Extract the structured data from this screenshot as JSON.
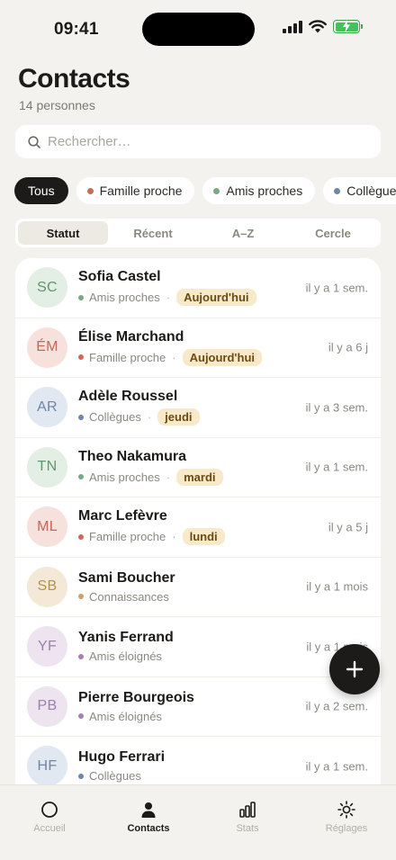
{
  "status_bar": {
    "time": "09:41"
  },
  "header": {
    "title": "Contacts",
    "subtitle": "14 personnes"
  },
  "search": {
    "placeholder": "Rechercher…",
    "value": ""
  },
  "filters": [
    {
      "label": "Tous",
      "active": true
    },
    {
      "label": "Famille proche",
      "dot_color": "#d0675a"
    },
    {
      "label": "Amis proches",
      "dot_color": "#7aa886"
    },
    {
      "label": "Collègues",
      "dot_color": "#6f86a8"
    }
  ],
  "sort_tabs": [
    {
      "label": "Statut",
      "active": true
    },
    {
      "label": "Récent"
    },
    {
      "label": "A–Z"
    },
    {
      "label": "Cercle"
    }
  ],
  "contacts": [
    {
      "initials": "SC",
      "name": "Sofia Castel",
      "circle": "Amis proches",
      "circle_color": "#7aa886",
      "badge": "Aujourd'hui",
      "last_seen": "il y a 1 sem.",
      "avatar_bg": "#e3efe4",
      "avatar_fg": "#5f9670"
    },
    {
      "initials": "ÉM",
      "name": "Élise Marchand",
      "circle": "Famille proche",
      "circle_color": "#d0675a",
      "badge": "Aujourd'hui",
      "last_seen": "il y a 6 j",
      "avatar_bg": "#f7e1dc",
      "avatar_fg": "#c36656"
    },
    {
      "initials": "AR",
      "name": "Adèle Roussel",
      "circle": "Collègues",
      "circle_color": "#6f86a8",
      "badge": "jeudi",
      "last_seen": "il y a 3 sem.",
      "avatar_bg": "#e2e8f1",
      "avatar_fg": "#6e85a7"
    },
    {
      "initials": "TN",
      "name": "Theo Nakamura",
      "circle": "Amis proches",
      "circle_color": "#7aa886",
      "badge": "mardi",
      "last_seen": "il y a 1 sem.",
      "avatar_bg": "#e3efe4",
      "avatar_fg": "#5f9670"
    },
    {
      "initials": "ML",
      "name": "Marc Lefèvre",
      "circle": "Famille proche",
      "circle_color": "#d0675a",
      "badge": "lundi",
      "last_seen": "il y a 5 j",
      "avatar_bg": "#f7e1dc",
      "avatar_fg": "#c36656"
    },
    {
      "initials": "SB",
      "name": "Sami Boucher",
      "circle": "Connaissances",
      "circle_color": "#c9a26e",
      "badge": "",
      "last_seen": "il y a 1 mois",
      "avatar_bg": "#f3e9d6",
      "avatar_fg": "#b39054"
    },
    {
      "initials": "YF",
      "name": "Yanis Ferrand",
      "circle": "Amis éloignés",
      "circle_color": "#a182b0",
      "badge": "",
      "last_seen": "il y a 1 mois",
      "avatar_bg": "#ede4f0",
      "avatar_fg": "#9b7fae"
    },
    {
      "initials": "PB",
      "name": "Pierre Bourgeois",
      "circle": "Amis éloignés",
      "circle_color": "#a182b0",
      "badge": "",
      "last_seen": "il y a 2 sem.",
      "avatar_bg": "#ede4f0",
      "avatar_fg": "#9b7fae"
    },
    {
      "initials": "HF",
      "name": "Hugo Ferrari",
      "circle": "Collègues",
      "circle_color": "#6f86a8",
      "badge": "",
      "last_seen": "il y a 1 sem.",
      "avatar_bg": "#e2e8f1",
      "avatar_fg": "#6e85a7"
    }
  ],
  "fab": {
    "icon": "plus-icon"
  },
  "tabbar": [
    {
      "label": "Accueil",
      "icon": "home-circle-icon"
    },
    {
      "label": "Contacts",
      "icon": "person-icon",
      "active": true
    },
    {
      "label": "Stats",
      "icon": "bar-chart-icon"
    },
    {
      "label": "Réglages",
      "icon": "sun-gear-icon"
    }
  ]
}
